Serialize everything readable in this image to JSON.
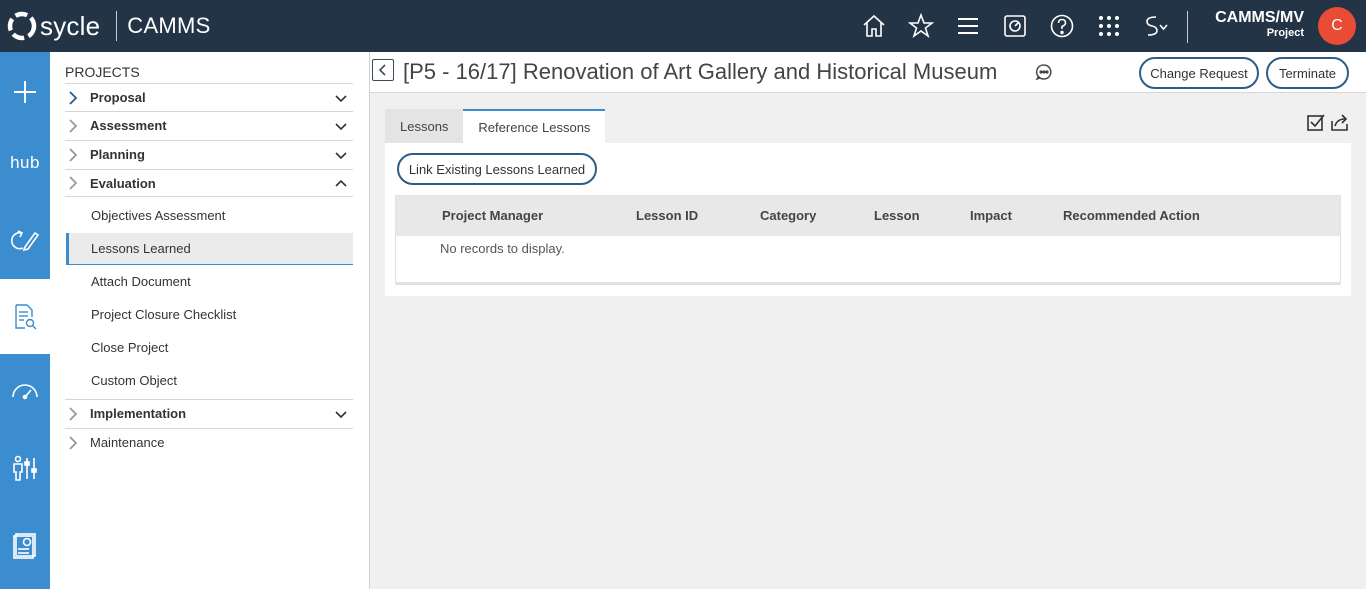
{
  "topbar": {
    "brand": "sycle",
    "product": "CAMMS",
    "nav_icons": [
      "home-icon",
      "star-icon",
      "menu-icon",
      "dashboard-icon",
      "help-icon",
      "apps-grid-icon",
      "switch-icon"
    ],
    "user_name": "CAMMS/MV",
    "user_role": "Project",
    "avatar_letter": "C",
    "avatar_color": "#e94b35",
    "bar_color": "#243447"
  },
  "rail": {
    "color": "#3c8dd0",
    "hub_label": "hub",
    "items": [
      "add-icon",
      "hub-icon",
      "edit-cycle-icon",
      "document-search-icon",
      "gauge-icon",
      "people-settings-icon",
      "report-icon"
    ]
  },
  "sidebar": {
    "title": "PROJECTS",
    "sections": {
      "proposal": "Proposal",
      "assessment": "Assessment",
      "planning": "Planning",
      "evaluation": "Evaluation",
      "implementation": "Implementation",
      "maintenance": "Maintenance"
    },
    "evaluation_items": {
      "objectives": "Objectives Assessment",
      "lessons": "Lessons Learned",
      "attach": "Attach Document",
      "checklist": "Project Closure Checklist",
      "close": "Close Project",
      "custom": "Custom Object"
    }
  },
  "header": {
    "title": "[P5 - 16/17] Renovation of Art Gallery and Historical Museum",
    "change_request": "Change Request",
    "terminate": "Terminate"
  },
  "tabs": {
    "lessons": "Lessons",
    "reference": "Reference Lessons"
  },
  "panel": {
    "link_button": "Link Existing Lessons Learned",
    "columns": {
      "pm": "Project Manager",
      "id": "Lesson ID",
      "category": "Category",
      "lesson": "Lesson",
      "impact": "Impact",
      "action": "Recommended Action"
    },
    "empty": "No records to display."
  }
}
